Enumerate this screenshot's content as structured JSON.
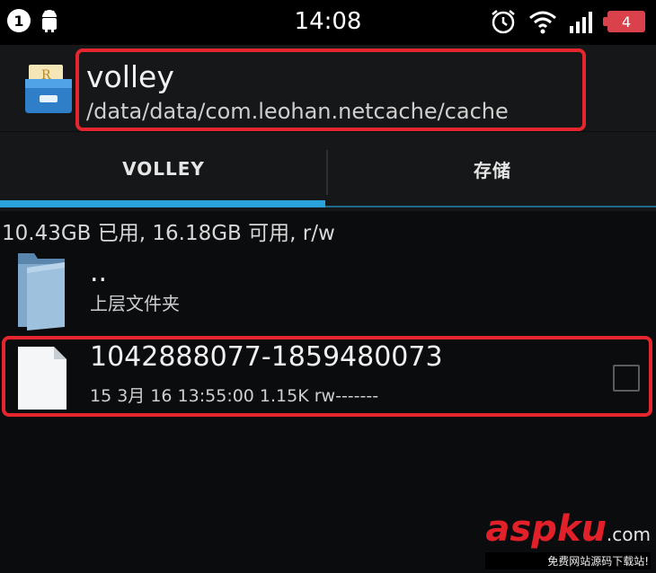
{
  "status_bar": {
    "notification_count": "1",
    "time": "14:08",
    "battery": "4",
    "icons": [
      "notification-count-icon",
      "android-icon",
      "alarm-icon",
      "wifi-icon",
      "signal-icon",
      "battery-icon"
    ]
  },
  "header": {
    "title": "volley",
    "path": "/data/data/com.leohan.netcache/cache"
  },
  "tabs": [
    {
      "label": "VOLLEY",
      "selected": true
    },
    {
      "label": "存储",
      "selected": false
    }
  ],
  "storage_info": "10.43GB 已用, 16.18GB 可用, r/w",
  "list": {
    "parent": {
      "name": "..",
      "sub": "上层文件夹",
      "icon": "folder-icon"
    },
    "files": [
      {
        "name": "1042888077-1859480073",
        "details": "15 3月 16 13:55:00  1.15K  rw-------",
        "icon": "file-icon",
        "checked": false
      }
    ]
  },
  "watermark": {
    "asp": "asp",
    "ku": "ku",
    "com": ".com",
    "sub": "免费网站源码下载站!"
  },
  "colors": {
    "accent": "#2aa2dc",
    "highlight_box": "#e6262e",
    "background": "#0b0c0d"
  }
}
